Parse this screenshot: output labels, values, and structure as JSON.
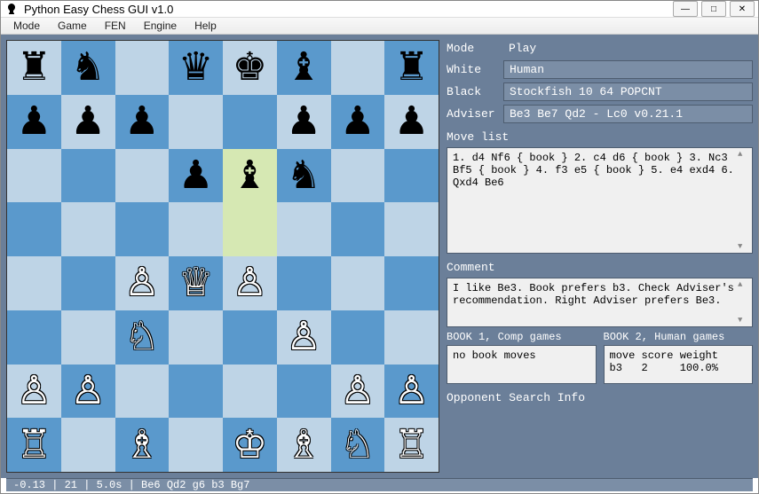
{
  "window": {
    "title": "Python Easy Chess GUI v1.0"
  },
  "menu": [
    "Mode",
    "Game",
    "FEN",
    "Engine",
    "Help"
  ],
  "info": {
    "mode_label": "Mode",
    "mode_value": "Play",
    "white_label": "White",
    "white_value": "Human",
    "black_label": "Black",
    "black_value": "Stockfish 10 64 POPCNT",
    "adviser_label": "Adviser",
    "adviser_value": "Be3 Be7 Qd2 - Lc0 v0.21.1"
  },
  "movelist": {
    "label": "Move list",
    "text": "1. d4 Nf6 { book } 2. c4 d6 { book } 3. Nc3 Bf5 { book } 4. f3 e5 { book } 5. e4 exd4 6. Qxd4 Be6"
  },
  "comment": {
    "label": "Comment",
    "text": "I like Be3. Book prefers b3. Check Adviser's recommendation. Right Adviser prefers Be3."
  },
  "book1": {
    "label": "BOOK 1, Comp games",
    "text": "no book moves"
  },
  "book2": {
    "label": "BOOK 2, Human games",
    "text": "move score weight\nb3   2     100.0%"
  },
  "opponent": {
    "label": "Opponent Search Info"
  },
  "status": {
    "text": "-0.13 | 21 | 5.0s | Be6 Qd2 g6 b3 Bg7"
  },
  "board": {
    "highlights": [
      "e6",
      "e5"
    ],
    "squares": [
      [
        "r",
        "n",
        "",
        "q",
        "k",
        "b",
        "",
        "r"
      ],
      [
        "p",
        "p",
        "p",
        "",
        "",
        "p",
        "p",
        "p"
      ],
      [
        "",
        "",
        "",
        "p",
        "b",
        "n",
        "",
        ""
      ],
      [
        "",
        "",
        "",
        "",
        "",
        "",
        "",
        ""
      ],
      [
        "",
        "",
        "P",
        "Q",
        "P",
        "",
        "",
        ""
      ],
      [
        "",
        "",
        "N",
        "",
        "",
        "P",
        "",
        ""
      ],
      [
        "P",
        "P",
        "",
        "",
        "",
        "",
        "P",
        "P"
      ],
      [
        "R",
        "",
        "B",
        "",
        "K",
        "B",
        "N",
        "R"
      ]
    ]
  },
  "piece_glyphs": {
    "K": "♔",
    "Q": "♕",
    "R": "♖",
    "B": "♗",
    "N": "♘",
    "P": "♙",
    "k": "♚",
    "q": "♛",
    "r": "♜",
    "b": "♝",
    "n": "♞",
    "p": "♟"
  }
}
